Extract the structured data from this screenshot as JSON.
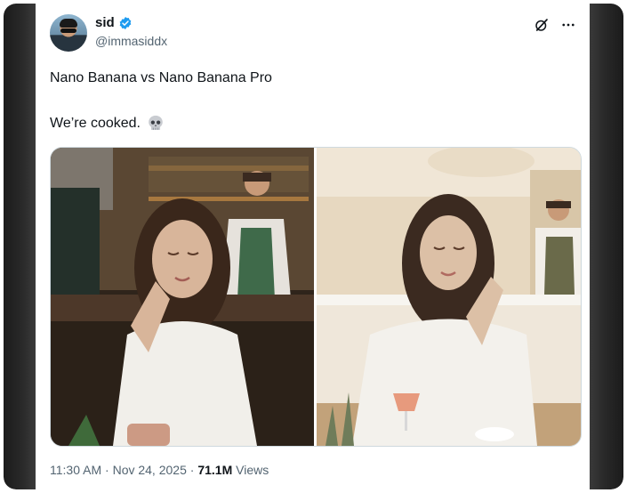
{
  "tweet": {
    "author": {
      "name": "sid",
      "handle": "@immasiddx"
    },
    "text_line1": "Nano Banana vs Nano Banana Pro",
    "text_line2": "We’re cooked.",
    "emoji": "skull",
    "time": "11:30 AM",
    "date": "Nov 24, 2025",
    "views_count": "71.1M",
    "views_label": "Views"
  },
  "icons": [
    "verified-badge-icon",
    "grok-icon",
    "more-options-icon",
    "skull-emoji-icon"
  ],
  "colors": {
    "verified_blue": "#1d9bf0",
    "text_primary": "#0f1419",
    "text_secondary": "#536471"
  }
}
